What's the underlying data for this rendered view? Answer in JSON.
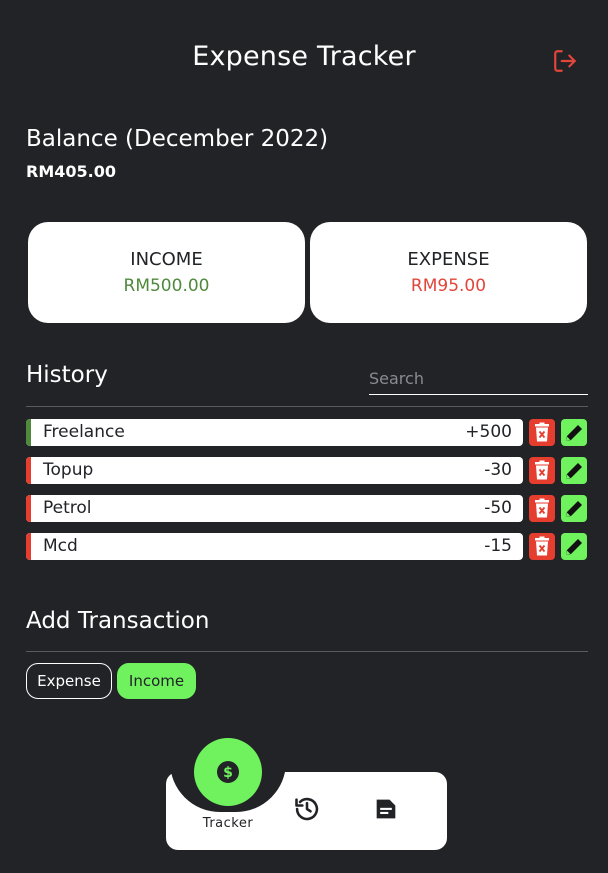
{
  "header": {
    "title": "Expense Tracker",
    "logout_icon": "logout-icon"
  },
  "balance": {
    "title": "Balance (December 2022)",
    "amount": "RM405.00"
  },
  "summary": {
    "income_label": "INCOME",
    "income_value": "RM500.00",
    "expense_label": "EXPENSE",
    "expense_value": "RM95.00"
  },
  "history": {
    "title": "History",
    "search_placeholder": "Search",
    "items": [
      {
        "name": "Freelance",
        "amount": "+500",
        "type": "income"
      },
      {
        "name": "Topup",
        "amount": "-30",
        "type": "expense"
      },
      {
        "name": "Petrol",
        "amount": "-50",
        "type": "expense"
      },
      {
        "name": "Mcd",
        "amount": "-15",
        "type": "expense"
      }
    ]
  },
  "add_transaction": {
    "title": "Add Transaction",
    "expense_label": "Expense",
    "income_label": "Income"
  },
  "nav": {
    "tracker_label": "Tracker",
    "items": [
      "dollar-icon",
      "history-icon",
      "document-icon"
    ]
  },
  "colors": {
    "background": "#222327",
    "income": "#6ff25e",
    "expense": "#e53e2f",
    "income_text": "#4f8a3c",
    "expense_text": "#e2463a"
  }
}
